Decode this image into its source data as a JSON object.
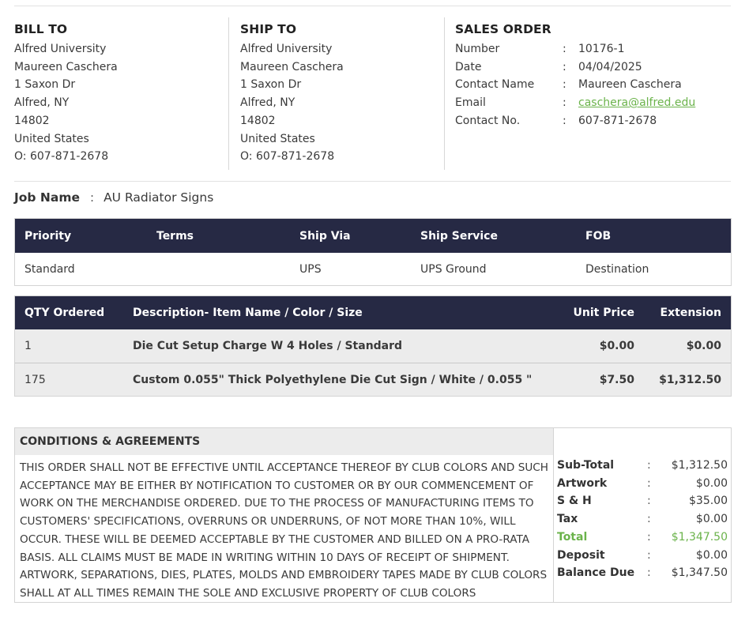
{
  "bill_to": {
    "title": "BILL TO",
    "lines": [
      "Alfred University",
      "Maureen Caschera",
      "1 Saxon Dr",
      "Alfred, NY",
      "14802",
      "United States",
      "O: 607-871-2678"
    ]
  },
  "ship_to": {
    "title": "SHIP TO",
    "lines": [
      "Alfred University",
      "Maureen Caschera",
      "1 Saxon Dr",
      "Alfred, NY",
      "14802",
      "United States",
      "O: 607-871-2678"
    ]
  },
  "sales_order": {
    "title": "SALES ORDER",
    "separator": ":",
    "rows": [
      {
        "label": "Number",
        "value": "10176-1"
      },
      {
        "label": "Date",
        "value": "04/04/2025"
      },
      {
        "label": "Contact Name",
        "value": "Maureen Caschera"
      },
      {
        "label": "Email",
        "value": "caschera@alfred.edu"
      },
      {
        "label": "Contact No.",
        "value": "607-871-2678"
      }
    ]
  },
  "job": {
    "label": "Job Name",
    "separator": ":",
    "value": "AU Radiator Signs"
  },
  "shipping_table": {
    "headers": [
      "Priority",
      "Terms",
      "Ship Via",
      "Ship Service",
      "FOB"
    ],
    "row": [
      "Standard",
      "",
      "UPS",
      "UPS Ground",
      "Destination"
    ]
  },
  "items_table": {
    "headers": [
      "QTY Ordered",
      "Description- Item Name / Color / Size",
      "Unit Price",
      "Extension"
    ],
    "rows": [
      [
        "1",
        "Die Cut Setup Charge W 4 Holes / Standard",
        "$0.00",
        "$0.00"
      ],
      [
        "175",
        "Custom 0.055\" Thick Polyethylene Die Cut Sign / White / 0.055 \"",
        "$7.50",
        "$1,312.50"
      ]
    ]
  },
  "conditions": {
    "title": "CONDITIONS & AGREEMENTS",
    "text": "THIS ORDER SHALL NOT BE EFFECTIVE UNTIL ACCEPTANCE THEREOF BY CLUB COLORS AND SUCH ACCEPTANCE MAY BE EITHER BY NOTIFICATION TO CUSTOMER OR BY OUR COMMENCEMENT OF WORK ON THE MERCHANDISE ORDERED. DUE TO THE PROCESS OF MANUFACTURING ITEMS TO CUSTOMERS' SPECIFICATIONS, OVERRUNS OR UNDERRUNS, OF NOT MORE THAN 10%, WILL OCCUR. THESE WILL BE DEEMED ACCEPTABLE BY THE CUSTOMER AND BILLED ON A PRO-RATA BASIS. ALL CLAIMS MUST BE MADE IN WRITING WITHIN 10 DAYS OF RECEIPT OF SHIPMENT. ARTWORK, SEPARATIONS, DIES, PLATES, MOLDS AND EMBROIDERY TAPES MADE BY CLUB COLORS SHALL AT ALL TIMES REMAIN THE SOLE AND EXCLUSIVE PROPERTY OF CLUB COLORS"
  },
  "totals": {
    "separator": ":",
    "rows": [
      {
        "label": "Sub-Total",
        "value": "$1,312.50"
      },
      {
        "label": "Artwork",
        "value": "$0.00"
      },
      {
        "label": "S & H",
        "value": "$35.00"
      },
      {
        "label": "Tax",
        "value": "$0.00"
      },
      {
        "label": "Total",
        "value": "$1,347.50"
      },
      {
        "label": "Deposit",
        "value": "$0.00"
      },
      {
        "label": "Balance Due",
        "value": "$1,347.50"
      }
    ]
  },
  "colors": {
    "header_bg": "#262944",
    "accent_green": "#6bb34b",
    "row_gray": "#ececec"
  }
}
